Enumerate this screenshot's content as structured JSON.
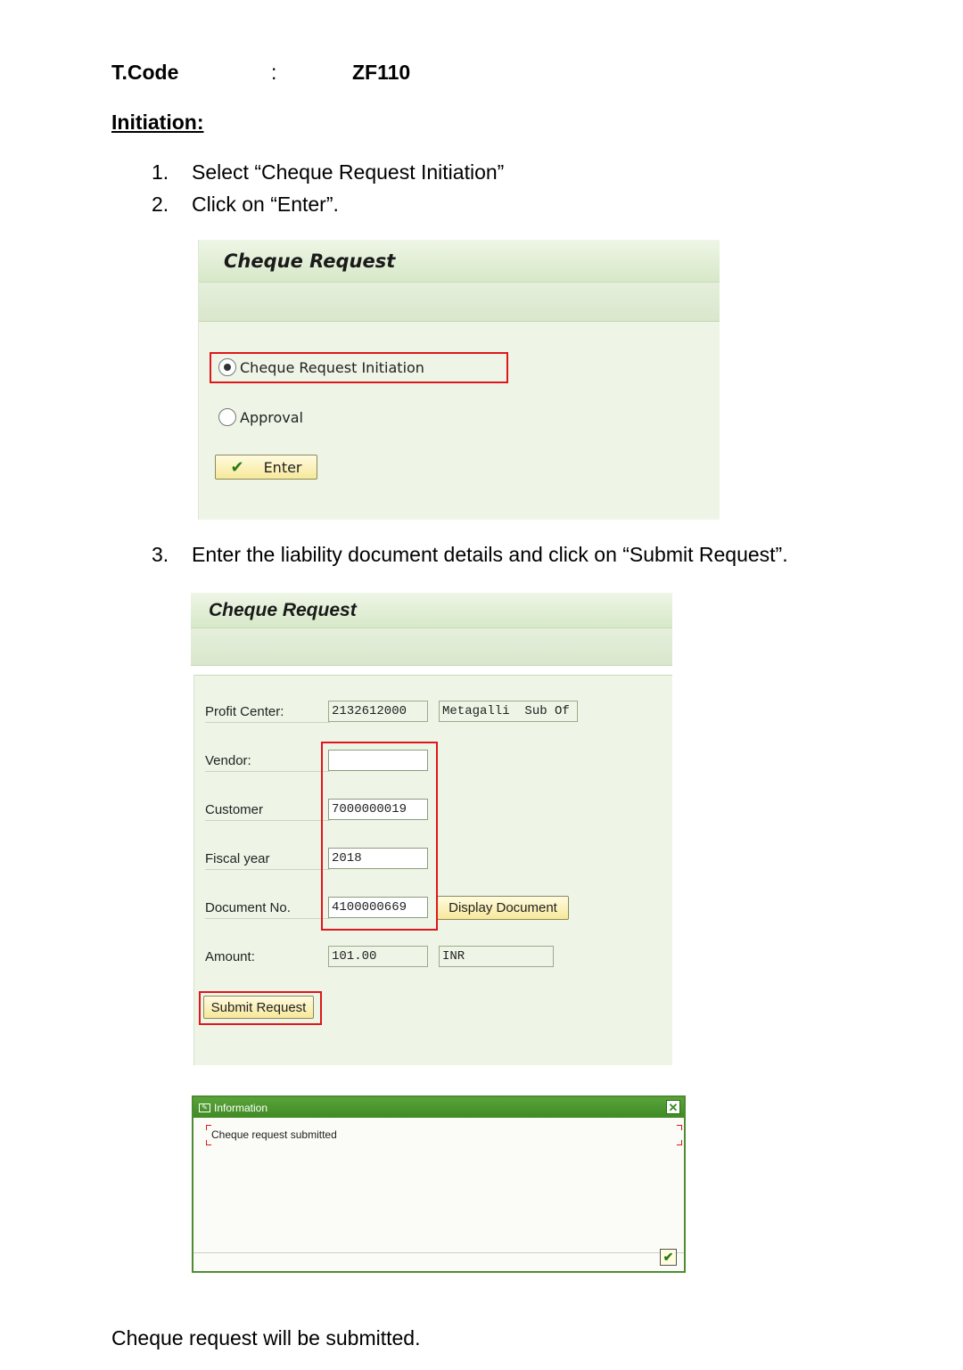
{
  "header": {
    "tcode_label": "T.Code",
    "separator": ":",
    "tcode_value": "ZF110"
  },
  "section": {
    "heading": "Initiation:"
  },
  "steps": [
    {
      "num": "1.",
      "text": "Select “Cheque Request Initiation”"
    },
    {
      "num": "2.",
      "text": "Click on “Enter”."
    },
    {
      "num": "3.",
      "text": "Enter the liability document details and click on “Submit Request”."
    }
  ],
  "screen1": {
    "title": "Cheque Request",
    "options": [
      {
        "label": "Cheque Request Initiation",
        "selected": true
      },
      {
        "label": "Approval",
        "selected": false
      }
    ],
    "enter_button": "Enter",
    "enter_icon": "checkmark-icon"
  },
  "screen2": {
    "title": "Cheque Request",
    "fields": {
      "profit_center": {
        "label": "Profit Center:",
        "value": "2132612000",
        "description": "Metagalli  Sub Of"
      },
      "vendor": {
        "label": "Vendor:",
        "value": ""
      },
      "customer": {
        "label": "Customer",
        "value": "7000000019"
      },
      "fiscal_year": {
        "label": "Fiscal year",
        "value": "2018"
      },
      "document_no": {
        "label": "Document No.",
        "value": "4100000669"
      },
      "amount": {
        "label": "Amount:",
        "value": "101.00",
        "currency": "INR"
      }
    },
    "display_document_button": "Display Document",
    "submit_button": "Submit Request"
  },
  "dialog": {
    "title": "Information",
    "title_icon": "info-window-icon",
    "message": "Cheque request submitted",
    "close_icon": "close-icon",
    "ok_icon": "checkmark-icon"
  },
  "closing": {
    "text": "Cheque request will be submitted."
  },
  "colors": {
    "highlight": "#e0161c",
    "sap_background": "#eef5e6",
    "dialog_titlebar": "#4e8c34"
  }
}
